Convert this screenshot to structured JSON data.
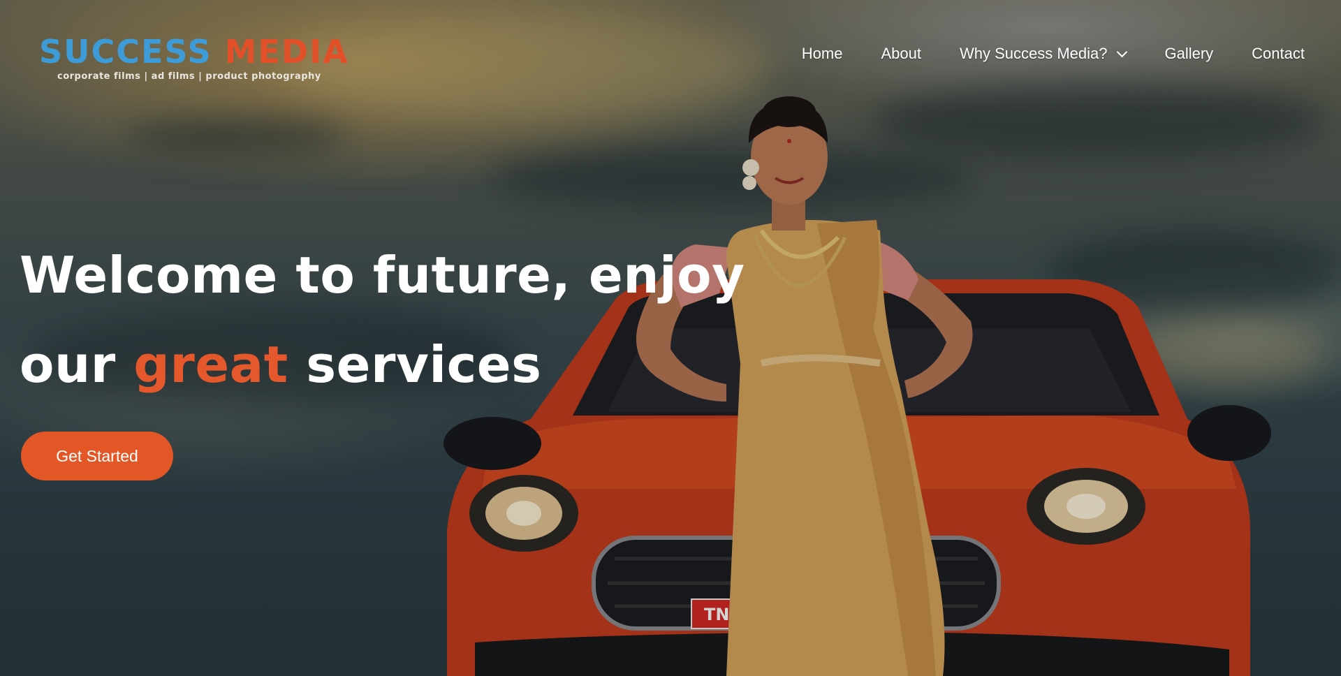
{
  "brand": {
    "name_part1": "SUCCESS",
    "name_part2": "MEDIA",
    "tagline": "corporate films | ad films | product photography",
    "primary_color": "#3d9bd8",
    "accent_color": "#e2502a"
  },
  "nav": {
    "items": [
      {
        "label": "Home"
      },
      {
        "label": "About"
      },
      {
        "label": "Why Success Media?",
        "has_dropdown": true,
        "icon": "chevron-down-icon"
      },
      {
        "label": "Gallery"
      },
      {
        "label": "Contact"
      }
    ]
  },
  "hero": {
    "line1": "Welcome to future, enjoy",
    "line2_before": "our ",
    "line2_accent": "great",
    "line2_after": " services",
    "cta_label": "Get Started",
    "cta_color": "#e35726",
    "plate_text": "TN",
    "image": "woman in saree posing in front of red car against cloudy sky"
  }
}
